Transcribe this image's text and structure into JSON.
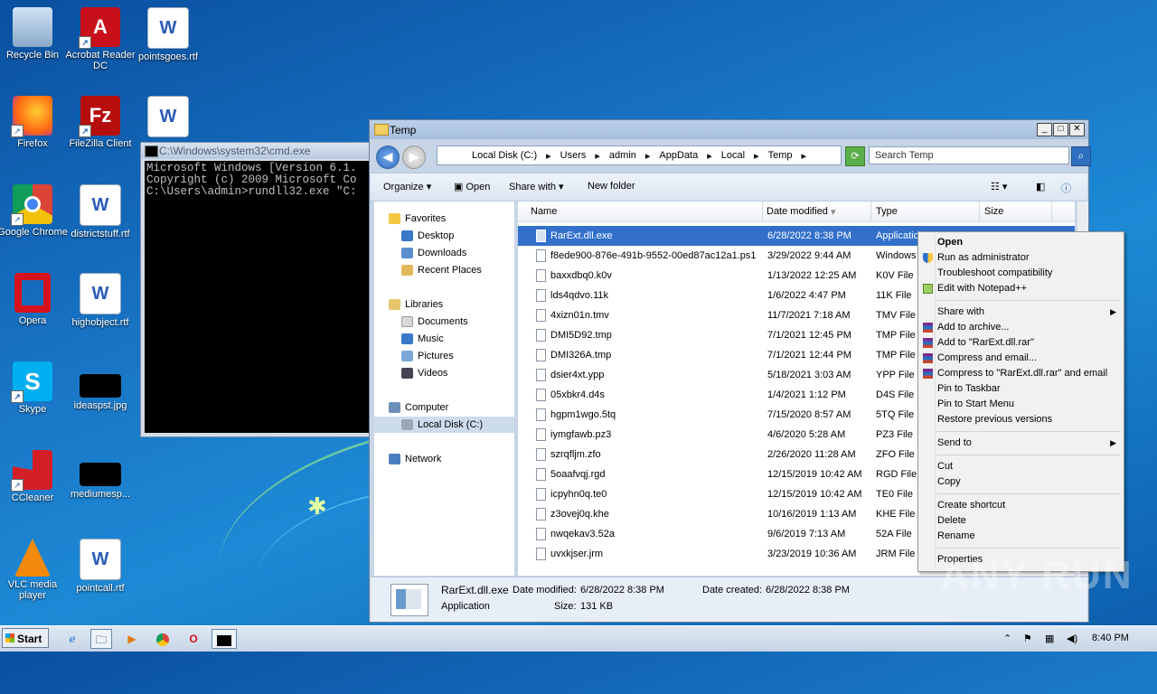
{
  "desktop": {
    "icons": [
      {
        "label": "Recycle Bin",
        "icon": "recycle-bin-icon"
      },
      {
        "label": "Acrobat Reader DC",
        "icon": "acrobat-icon"
      },
      {
        "label": "pointsgoes.rtf",
        "icon": "word-doc-icon"
      },
      {
        "label": "Firefox",
        "icon": "firefox-icon"
      },
      {
        "label": "FileZilla Client",
        "icon": "filezilla-icon"
      },
      {
        "label": "Google Chrome",
        "icon": "chrome-icon"
      },
      {
        "label": "districtstuff.rtf",
        "icon": "word-doc-icon"
      },
      {
        "label": "Opera",
        "icon": "opera-icon"
      },
      {
        "label": "highobject.rtf",
        "icon": "word-doc-icon"
      },
      {
        "label": "Skype",
        "icon": "skype-icon"
      },
      {
        "label": "ideaspst.jpg",
        "icon": "image-icon"
      },
      {
        "label": "CCleaner",
        "icon": "ccleaner-icon"
      },
      {
        "label": "mediumesp...",
        "icon": "image-icon"
      },
      {
        "label": "VLC media player",
        "icon": "vlc-icon"
      },
      {
        "label": "pointcall.rtf",
        "icon": "word-doc-icon"
      }
    ]
  },
  "cmd": {
    "title": "C:\\Windows\\system32\\cmd.exe",
    "line1": "Microsoft Windows [Version 6.1.",
    "line2": "Copyright (c) 2009 Microsoft Co",
    "line3": "",
    "line4": "C:\\Users\\admin>rundll32.exe \"C:"
  },
  "explorer": {
    "title": "Temp",
    "breadcrumbs": [
      "Local Disk (C:)",
      "Users",
      "admin",
      "AppData",
      "Local",
      "Temp"
    ],
    "search_placeholder": "Search Temp",
    "toolbar": {
      "organize": "Organize",
      "open": "Open",
      "share_with": "Share with",
      "new_folder": "New folder"
    },
    "nav": {
      "favorites": "Favorites",
      "desktop": "Desktop",
      "downloads": "Downloads",
      "recent_places": "Recent Places",
      "libraries": "Libraries",
      "documents": "Documents",
      "music": "Music",
      "pictures": "Pictures",
      "videos": "Videos",
      "computer": "Computer",
      "local_disk": "Local Disk (C:)",
      "network": "Network"
    },
    "columns": {
      "name": "Name",
      "date_modified": "Date modified",
      "type": "Type",
      "size": "Size"
    },
    "files": [
      {
        "name": "RarExt.dll.exe",
        "date": "6/28/2022 8:38 PM",
        "type": "Application"
      },
      {
        "name": "f8ede900-876e-491b-9552-00ed87ac12a1.ps1",
        "date": "3/29/2022 9:44 AM",
        "type": "Windows"
      },
      {
        "name": "baxxdbq0.k0v",
        "date": "1/13/2022 12:25 AM",
        "type": "K0V File"
      },
      {
        "name": "lds4qdvo.11k",
        "date": "1/6/2022 4:47 PM",
        "type": "11K File"
      },
      {
        "name": "4xizn01n.tmv",
        "date": "11/7/2021 7:18 AM",
        "type": "TMV File"
      },
      {
        "name": "DMI5D92.tmp",
        "date": "7/1/2021 12:45 PM",
        "type": "TMP File"
      },
      {
        "name": "DMI326A.tmp",
        "date": "7/1/2021 12:44 PM",
        "type": "TMP File"
      },
      {
        "name": "dsier4xt.ypp",
        "date": "5/18/2021 3:03 AM",
        "type": "YPP File"
      },
      {
        "name": "05xbkr4.d4s",
        "date": "1/4/2021 1:12 PM",
        "type": "D4S File"
      },
      {
        "name": "hgpm1wgo.5tq",
        "date": "7/15/2020 8:57 AM",
        "type": "5TQ File"
      },
      {
        "name": "iymgfawb.pz3",
        "date": "4/6/2020 5:28 AM",
        "type": "PZ3 File"
      },
      {
        "name": "szrqfljm.zfo",
        "date": "2/26/2020 11:28 AM",
        "type": "ZFO File"
      },
      {
        "name": "5oaafvqj.rgd",
        "date": "12/15/2019 10:42 AM",
        "type": "RGD File"
      },
      {
        "name": "icpyhn0q.te0",
        "date": "12/15/2019 10:42 AM",
        "type": "TE0 File"
      },
      {
        "name": "z3ovej0q.khe",
        "date": "10/16/2019 1:13 AM",
        "type": "KHE File"
      },
      {
        "name": "nwqekav3.52a",
        "date": "9/6/2019 7:13 AM",
        "type": "52A File"
      },
      {
        "name": "uvxkjser.jrm",
        "date": "3/23/2019 10:36 AM",
        "type": "JRM File"
      }
    ],
    "details": {
      "name": "RarExt.dll.exe",
      "kind": "Application",
      "date_modified_label": "Date modified:",
      "date_modified": "6/28/2022 8:38 PM",
      "date_created_label": "Date created:",
      "date_created": "6/28/2022 8:38 PM",
      "size_label": "Size:",
      "size": "131 KB"
    }
  },
  "context_menu": {
    "items": [
      "Open",
      "Run as administrator",
      "Troubleshoot compatibility",
      "Edit with Notepad++",
      "Share with",
      "Add to archive...",
      "Add to \"RarExt.dll.rar\"",
      "Compress and email...",
      "Compress to \"RarExt.dll.rar\" and email",
      "Pin to Taskbar",
      "Pin to Start Menu",
      "Restore previous versions",
      "Send to",
      "Cut",
      "Copy",
      "Create shortcut",
      "Delete",
      "Rename",
      "Properties"
    ]
  },
  "watermark": "ANY RUN",
  "taskbar": {
    "start": "Start",
    "clock": "8:40 PM"
  }
}
